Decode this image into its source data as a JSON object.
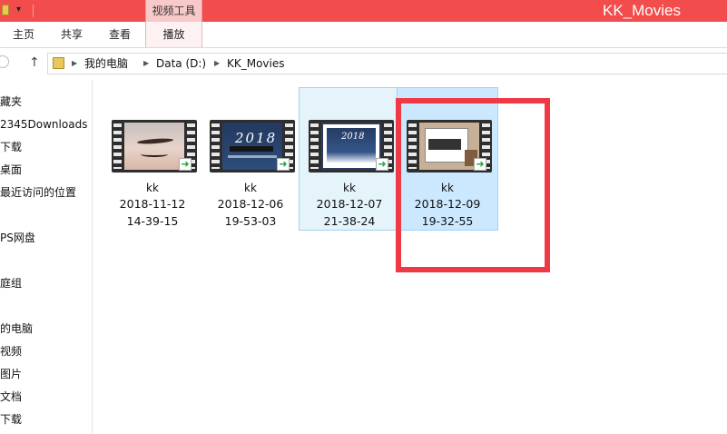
{
  "window": {
    "title": "KK_Movies",
    "context_tab": "视频工具"
  },
  "ribbon": {
    "tabs": [
      {
        "label": "主页"
      },
      {
        "label": "共享"
      },
      {
        "label": "查看"
      },
      {
        "label": "播放"
      }
    ]
  },
  "address": {
    "crumbs": [
      "我的电脑",
      "Data (D:)",
      "KK_Movies"
    ]
  },
  "nav": {
    "items": [
      {
        "label": "藏夹"
      },
      {
        "label": "2345Downloads"
      },
      {
        "label": "下载"
      },
      {
        "label": "桌面"
      },
      {
        "label": "最近访问的位置"
      },
      {
        "label": "PS网盘"
      },
      {
        "label": "庭组"
      },
      {
        "label": "的电脑"
      },
      {
        "label": "视频"
      },
      {
        "label": "图片"
      },
      {
        "label": "文档"
      },
      {
        "label": "下载"
      }
    ]
  },
  "files": [
    {
      "name": "kk",
      "date": "2018-11-12",
      "time": "14-39-15",
      "state": "normal"
    },
    {
      "name": "kk",
      "date": "2018-12-06",
      "time": "19-53-03",
      "state": "normal"
    },
    {
      "name": "kk",
      "date": "2018-12-07",
      "time": "21-38-24",
      "state": "hover"
    },
    {
      "name": "kk",
      "date": "2018-12-09",
      "time": "19-32-55",
      "state": "selected"
    }
  ],
  "thumbs": {
    "year_text": "2018"
  },
  "colors": {
    "titlebar": "#f24c4c",
    "annotation": "#ef3a46",
    "selected": "#cce8ff",
    "hover": "#e5f3fb"
  }
}
